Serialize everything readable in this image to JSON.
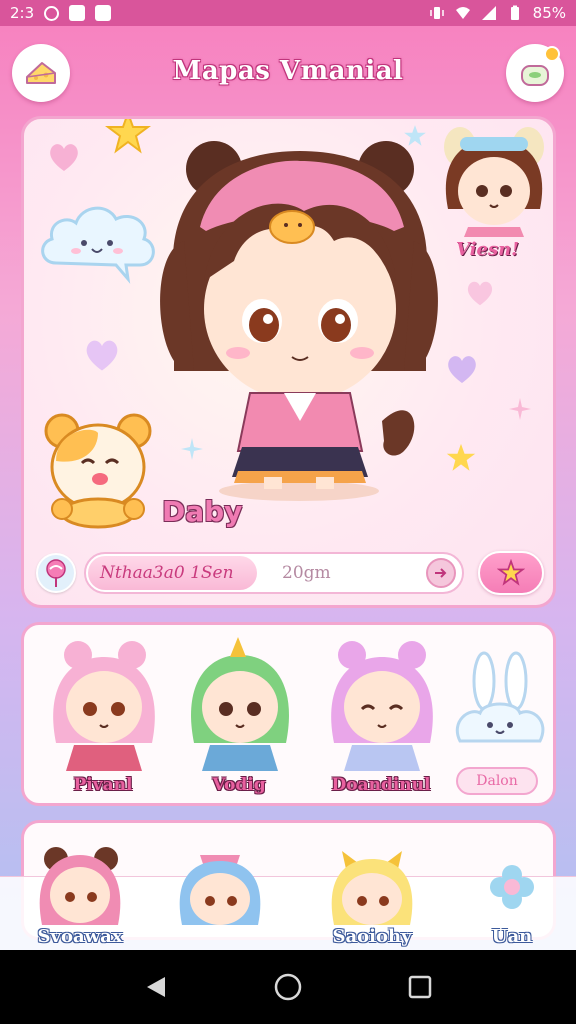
{
  "status_bar": {
    "time": "2:3",
    "battery": "85%"
  },
  "header": {
    "title": "Mapas Vmanial",
    "left_icon": "cheese-icon",
    "right_icon": "bag-icon"
  },
  "hero": {
    "name": "Daby",
    "side_label": "Viesn!",
    "bar": {
      "fill_fraction": 0.45,
      "text": "Nthaa3a0 1Sen",
      "time": "20gm",
      "left_icon": "lollipop-icon",
      "go_icon": "arrow-right-icon",
      "fav_icon": "star-icon"
    }
  },
  "characters": [
    {
      "label": "Pivanl"
    },
    {
      "label": "Vodig"
    },
    {
      "label": "Doandinul"
    }
  ],
  "characters_action": "Dalon",
  "bottom_nav": [
    {
      "label": "Svoawax"
    },
    {
      "label": ""
    },
    {
      "label": "Saoiohy"
    },
    {
      "label": "Uan"
    }
  ],
  "colors": {
    "accent": "#f57db6",
    "status_bar": "#d9559b",
    "card_border": "#f3a6cf"
  }
}
